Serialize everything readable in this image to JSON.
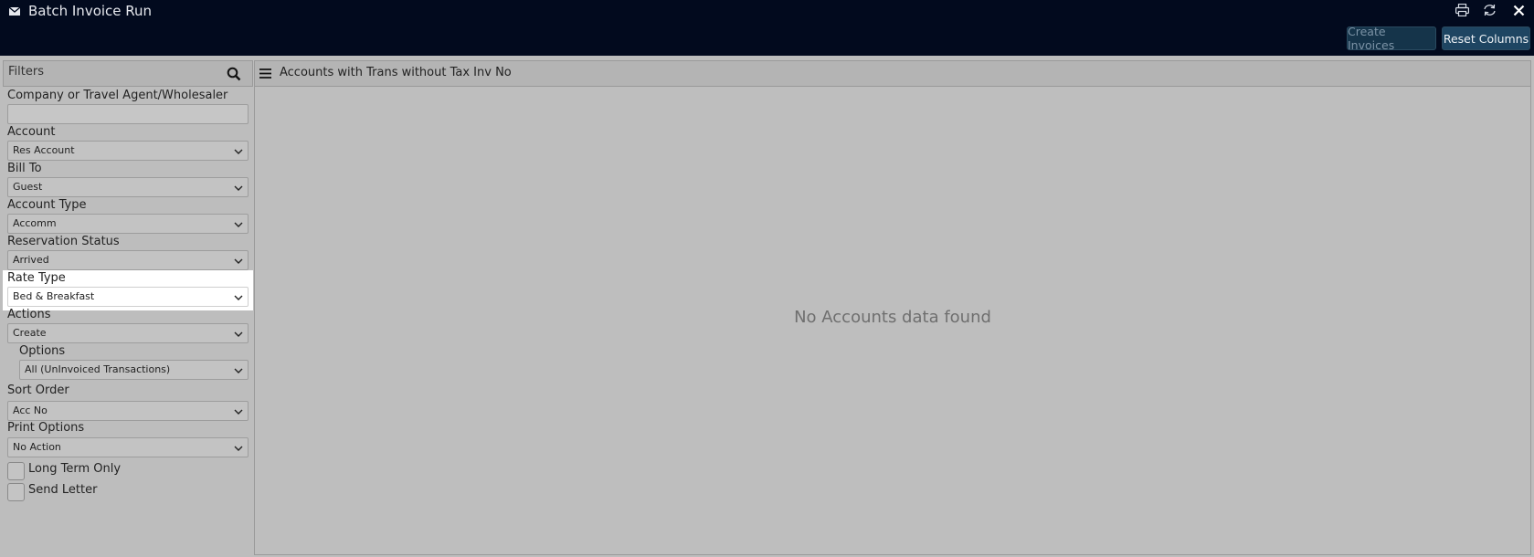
{
  "window": {
    "title": "Batch Invoice Run",
    "icons": [
      "envelope-icon",
      "print-icon",
      "refresh-icon",
      "close-icon"
    ]
  },
  "toolbar": {
    "create_invoices_label": "Create Invoices",
    "reset_columns_label": "Reset Columns"
  },
  "filters": {
    "title": "Filters",
    "company_label": "Company or Travel Agent/Wholesaler",
    "company_value": "",
    "account_label": "Account",
    "account_value": "Res Account",
    "bill_to_label": "Bill To",
    "bill_to_value": "Guest",
    "account_type_label": "Account Type",
    "account_type_value": "Accomm",
    "reservation_status_label": "Reservation Status",
    "reservation_status_value": "Arrived",
    "rate_type_label": "Rate Type",
    "rate_type_value": "Bed & Breakfast",
    "actions_label": "Actions",
    "actions_value": "Create",
    "options_label": "Options",
    "options_value": "All (UnInvoiced Transactions)",
    "sort_order_label": "Sort Order",
    "sort_order_value": "Acc No",
    "print_options_label": "Print Options",
    "print_options_value": "No Action",
    "long_term_only_label": "Long Term Only",
    "long_term_only_checked": false,
    "send_letter_label": "Send Letter",
    "send_letter_checked": false
  },
  "grid": {
    "title": "Accounts with Trans without Tax Inv No",
    "empty_message": "No Accounts data found"
  },
  "colors": {
    "topbar": "#020a1e",
    "panel_bg": "#bdbdbd",
    "highlight": "#ffffff",
    "button_active": "#1e4562"
  }
}
